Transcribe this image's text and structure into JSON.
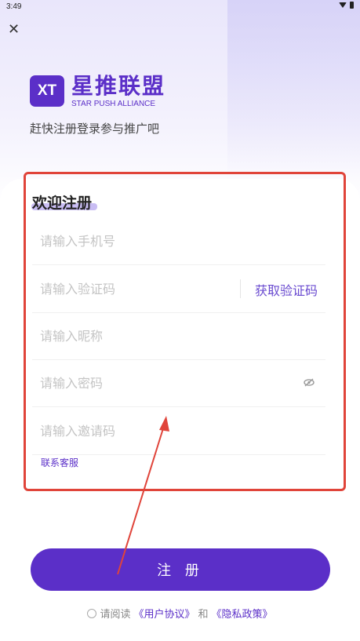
{
  "status_bar": {
    "time": "3:49"
  },
  "header": {
    "logo_badge": "XT",
    "brand_name": "星推联盟",
    "brand_en": "STAR PUSH ALLIANCE",
    "tagline": "赶快注册登录参与推广吧"
  },
  "form": {
    "title": "欢迎注册",
    "phone_placeholder": "请输入手机号",
    "code_placeholder": "请输入验证码",
    "get_code_label": "获取验证码",
    "nickname_placeholder": "请输入昵称",
    "password_placeholder": "请输入密码",
    "invite_placeholder": "请输入邀请码",
    "contact_label": "联系客服"
  },
  "actions": {
    "register_label": "注 册"
  },
  "agreement": {
    "prefix": "请阅读",
    "user_agreement": "《用户协议》",
    "and": "和",
    "privacy_policy": "《隐私政策》"
  },
  "colors": {
    "accent": "#5b2fc8",
    "annotation": "#e0443a"
  },
  "icons": [
    "close-icon",
    "wifi-icon",
    "battery-icon",
    "eye-off-icon",
    "radio-icon"
  ]
}
